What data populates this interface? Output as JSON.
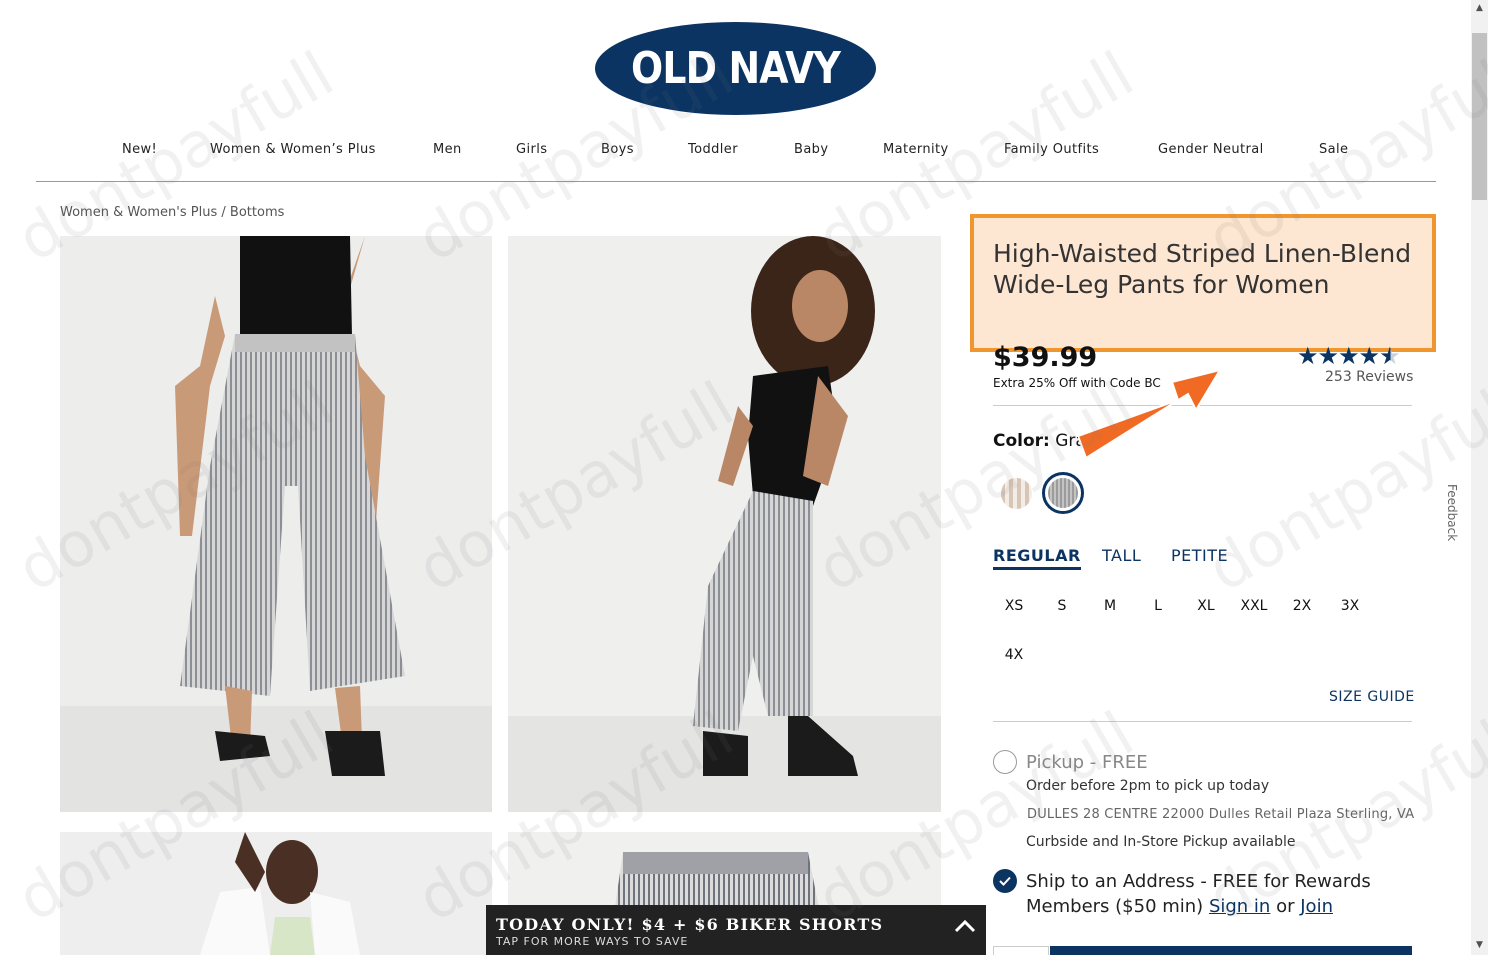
{
  "brand": {
    "logo_text": "OLD NAVY",
    "primary_color": "#0b3462",
    "highlight_color": "#f0962e"
  },
  "nav": {
    "items": [
      "New!",
      "Women & Women’s Plus",
      "Men",
      "Girls",
      "Boys",
      "Toddler",
      "Baby",
      "Maternity",
      "Family Outfits",
      "Gender Neutral",
      "Sale"
    ]
  },
  "breadcrumb": {
    "parent": "Women & Women's Plus",
    "separator": "/",
    "current": "Bottoms"
  },
  "product": {
    "title": "High-Waisted Striped Linen-Blend Wide-Leg Pants for Women",
    "price": "$39.99",
    "promo": "Extra 25% Off with Code BC",
    "rating": 4.5,
    "reviews": "253 Reviews",
    "color_label": "Color:",
    "color_value": "Gray",
    "swatches": [
      {
        "name": "beige-stripe"
      },
      {
        "name": "gray",
        "selected": true
      }
    ],
    "fit_tabs": [
      "REGULAR",
      "TALL",
      "PETITE"
    ],
    "sizes": [
      "XS",
      "S",
      "M",
      "L",
      "XL",
      "XXL",
      "2X",
      "3X",
      "4X"
    ],
    "size_guide": "SIZE GUIDE"
  },
  "fulfillment": {
    "pickup_title": "Pickup - FREE",
    "pickup_deadline": "Order before 2pm to pick up today",
    "pickup_address": "DULLES 28 CENTRE 22000 Dulles Retail Plaza  Sterling, VA",
    "pickup_note": "Curbside and In-Store Pickup available",
    "ship_text": "Ship to an Address - FREE for Rewards Members ($50 min)",
    "sign_in": "Sign in",
    "or": "or",
    "join": "Join"
  },
  "promo_bar": {
    "main": "TODAY ONLY! $4 + $6 BIKER SHORTS",
    "sub": "TAP FOR MORE WAYS TO SAVE"
  },
  "feedback": "Feedback",
  "watermark": "dontpayfull"
}
